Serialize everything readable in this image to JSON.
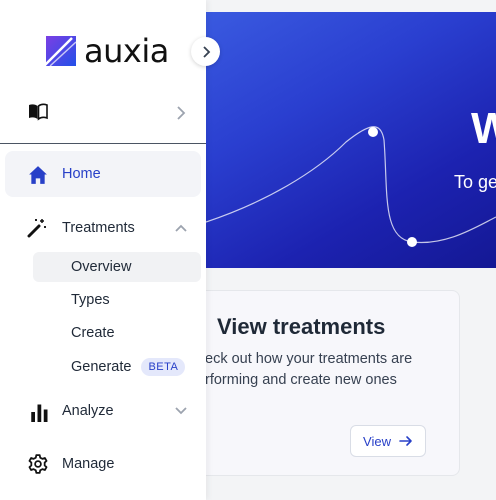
{
  "brand": {
    "name": "auxia",
    "accent": "#2840c8"
  },
  "sidebar": {
    "collapse_icon": "chevron-right-icon",
    "docs": {
      "icon": "book-icon",
      "chevron": "chevron-right-icon"
    },
    "items": [
      {
        "label": "Home",
        "icon": "home-icon",
        "active": true
      },
      {
        "label": "Treatments",
        "icon": "magic-wand-icon",
        "chevron": "chevron-up-icon",
        "children": [
          {
            "label": "Overview",
            "active": true
          },
          {
            "label": "Types"
          },
          {
            "label": "Create"
          },
          {
            "label": "Generate",
            "badge": "BETA"
          }
        ]
      },
      {
        "label": "Analyze",
        "icon": "bar-chart-icon",
        "chevron": "chevron-down-icon"
      },
      {
        "label": "Manage",
        "icon": "gear-icon"
      }
    ]
  },
  "hero": {
    "title": "W",
    "subtitle": "To ge"
  },
  "card": {
    "title": "View treatments",
    "description": "eck out how your treatments are rforming and create new ones",
    "button_label": "View"
  }
}
